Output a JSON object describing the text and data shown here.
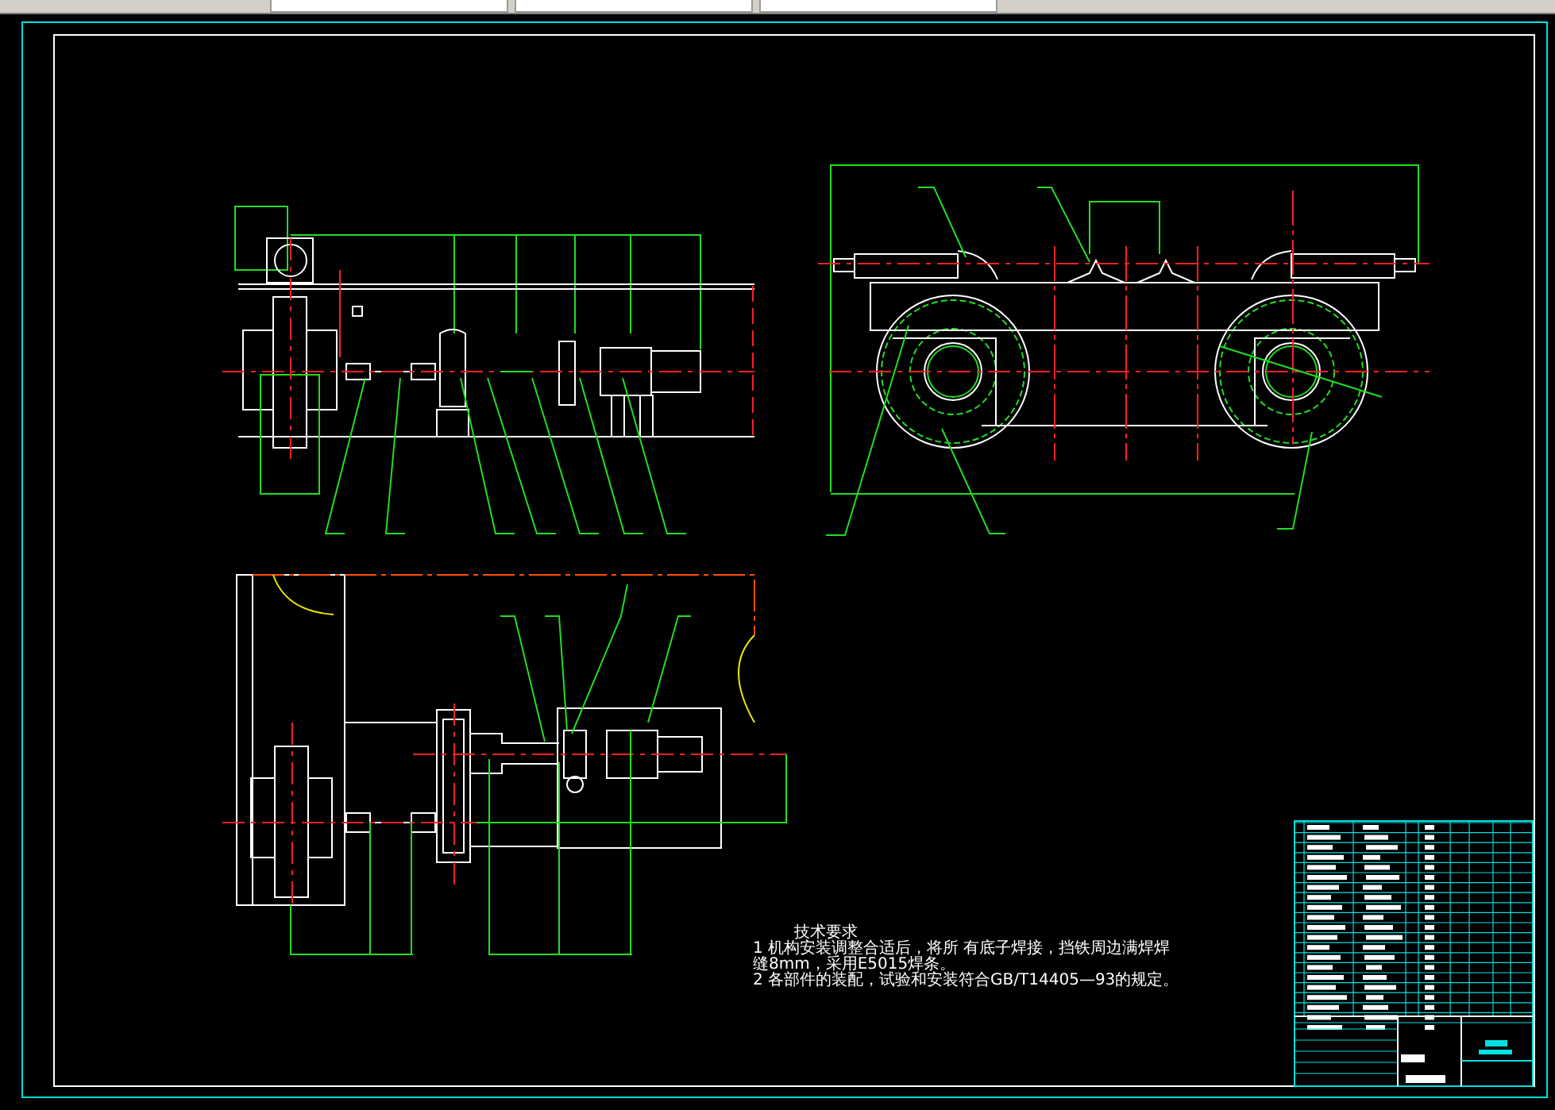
{
  "technical_requirements": {
    "title": "技术要求",
    "lines": [
      "1  机构安装调整合适后，将所  有底子焊接，挡铁周边满焊焊",
      "缝8mm，采用E5015焊条。",
      "2  各部件的装配，试验和安装符合GB/T14405—93的规定。"
    ]
  }
}
